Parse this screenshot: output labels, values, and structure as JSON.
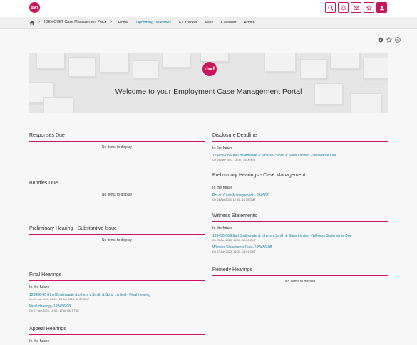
{
  "logo": {
    "text": "dwf"
  },
  "brand_color": "#c8155b",
  "link_color": "#0e7b9c",
  "top_icons": [
    "search-icon",
    "bell-icon",
    "mail-icon",
    "star-icon",
    "user-icon"
  ],
  "breadcrumb": {
    "site": "[DEMO] ET Case Management Por...",
    "caret": "▾"
  },
  "nav": {
    "links": [
      "Home",
      "Upcoming Deadlines",
      "ET Tracker",
      "Files",
      "Calendar",
      "Admin"
    ],
    "active_index": 1
  },
  "banner": {
    "logo_text": "dwf",
    "title": "Welcome to your Employment Case Management Portal"
  },
  "left": {
    "responses": {
      "title": "Responses Due",
      "empty": "No items to display"
    },
    "bundles": {
      "title": "Bundles Due",
      "empty": "No items to display"
    },
    "prelim_substantive": {
      "title": "Preliminary Hearing - Substantive Issue",
      "empty": "No items to display"
    },
    "final": {
      "title": "Final Hearings",
      "subtitle": "In the future",
      "items": [
        {
          "link": "123456-06 Ethel Braithwaite & others v Smith & Sons Limited - Final Hearing",
          "meta": "On 26 Jun 2023, 00:00 - 28 Jun 2023, 00:00 GMT"
        },
        {
          "link": "Final Hearing - 123456-08",
          "meta": "On 07 Sep 2023, 10:00 - 17:00 GMT TBC"
        }
      ]
    },
    "appeal": {
      "title": "Appeal Hearings",
      "subtitle": "In the future"
    }
  },
  "right": {
    "disclosure": {
      "title": "Disclosure Deadline",
      "subtitle": "In the future",
      "items": [
        {
          "link": "123456-06 Ethel Braithwaite & others v Smith & Sons Limited - Disclosure Due",
          "meta": "On 05 May 2023, 13:00 - 14:00 BST"
        }
      ]
    },
    "prelim_case": {
      "title": "Preliminary Hearings - Case Management",
      "subtitle": "In the future",
      "items": [
        {
          "link": "PH on Case Management - 234567",
          "meta": "On 04 Apr 2023, 12:00 - 13:30 GMT"
        }
      ]
    },
    "witness": {
      "title": "Witness Statements",
      "subtitle": "In the future",
      "items": [
        {
          "link": "123456-06 Ethel Braithwaite & others v Smith & Sons Limited - Witness Statements Due",
          "meta": "On 23 Jun 2023, 15:00 - 16:00 GMT"
        },
        {
          "link": "Witness Statements Due - 123456-08",
          "meta": "On 07 Jun 2023, 16:00 - 16:01 GMT"
        }
      ]
    },
    "remedy": {
      "title": "Remedy Hearings",
      "empty": "No items to display"
    }
  }
}
